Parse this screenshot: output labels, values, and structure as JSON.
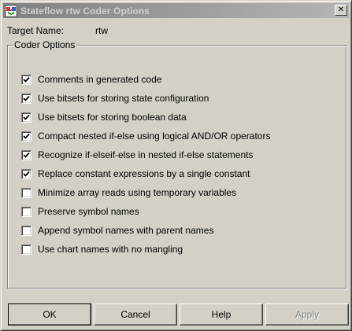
{
  "window": {
    "title": "Stateflow rtw Coder Options",
    "close_glyph": "✕"
  },
  "target": {
    "label": "Target Name:",
    "value": "rtw"
  },
  "coder_options": {
    "legend": "Coder Options",
    "items": [
      {
        "label": "Comments in generated code",
        "checked": true
      },
      {
        "label": "Use bitsets for storing state configuration",
        "checked": true
      },
      {
        "label": "Use bitsets for storing boolean data",
        "checked": true
      },
      {
        "label": "Compact nested if-else using logical AND/OR operators",
        "checked": true
      },
      {
        "label": "Recognize if-elseif-else in nested if-else statements",
        "checked": true
      },
      {
        "label": "Replace constant expressions by a single constant",
        "checked": true
      },
      {
        "label": "Minimize array reads using temporary variables",
        "checked": false
      },
      {
        "label": "Preserve symbol names",
        "checked": false
      },
      {
        "label": "Append symbol names with parent names",
        "checked": false
      },
      {
        "label": "Use chart names with no mangling",
        "checked": false
      }
    ]
  },
  "buttons": {
    "ok": "OK",
    "cancel": "Cancel",
    "help": "Help",
    "apply": "Apply",
    "apply_enabled": false
  },
  "icons": {
    "app": "stateflow-app-icon",
    "close": "close-icon",
    "check": "checkmark-icon"
  },
  "colors": {
    "face": "#d4d0c8",
    "title_gradient_start": "#808080",
    "title_text": "#d4d0c8",
    "disabled_text": "#808080"
  }
}
